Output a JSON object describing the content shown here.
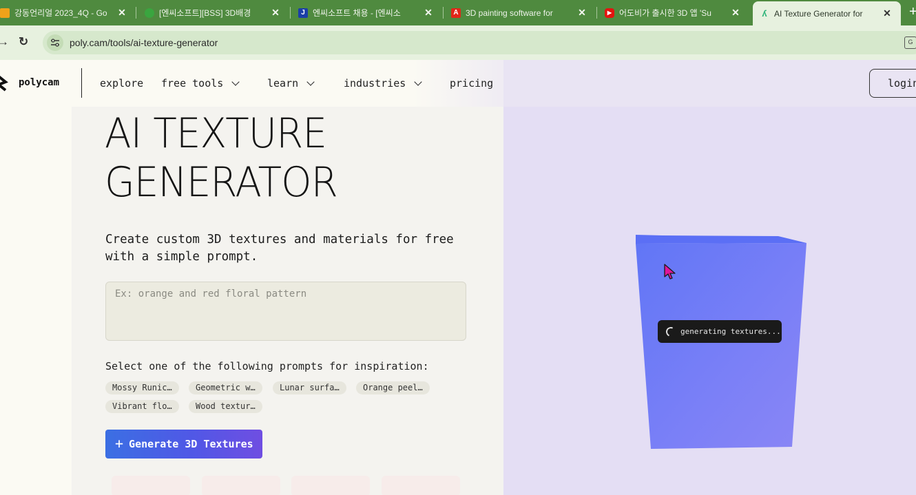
{
  "browser": {
    "tabs": [
      {
        "title": "강동언리얼 2023_4Q - Go",
        "favicon": "orange-square-icon",
        "active": false
      },
      {
        "title": "[엔씨소프트][BSS] 3D배경",
        "favicon": "green-blob-icon",
        "active": false
      },
      {
        "title": "엔씨소프트 채용 - [엔씨소",
        "favicon": "j-letter-icon",
        "active": false
      },
      {
        "title": "3D painting software for",
        "favicon": "adobe-icon",
        "active": false
      },
      {
        "title": "어도비가 출시한 3D 앱 'Su",
        "favicon": "youtube-icon",
        "active": false
      },
      {
        "title": "AI Texture Generator for",
        "favicon": "polycam-icon",
        "active": true
      }
    ],
    "url": "poly.cam/tools/ai-texture-generator",
    "colors": {
      "tabbar": "#4f8a3f",
      "toolbar": "#e7f1df"
    }
  },
  "nav": {
    "brand": "polycam",
    "links": [
      "explore",
      "free tools",
      "learn",
      "industries",
      "pricing"
    ],
    "login": "login"
  },
  "hero": {
    "title_line1": "AI TEXTURE",
    "title_line2": "GENERATOR",
    "subtitle": "Create custom 3D textures and materials for free with a simple prompt.",
    "prompt_placeholder": "Ex: orange and red floral pattern",
    "inspiration_label": "Select one of the following prompts for inspiration:",
    "chips": [
      "Mossy Runic…",
      "Geometric w…",
      "Lunar surfa…",
      "Orange peel…",
      "Vibrant flo…",
      "Wood textur…"
    ],
    "generate_button": "Generate 3D Textures"
  },
  "preview": {
    "status": "generating textures...",
    "cube_color": "#7b80f7",
    "background": "#e4def4"
  },
  "colors": {
    "accent_gradient_start": "#3b6fe3",
    "accent_gradient_end": "#6f4ee2",
    "cursor": "#e0169a"
  }
}
